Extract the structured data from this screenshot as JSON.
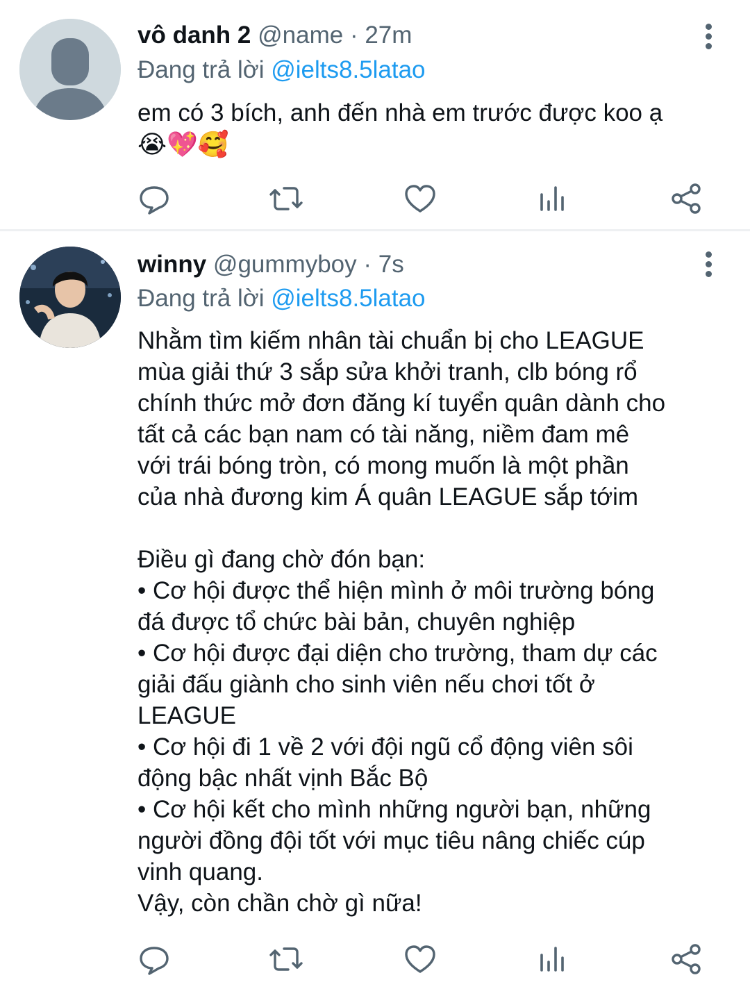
{
  "tweets": [
    {
      "display_name": "vô danh 2",
      "handle": "@name",
      "separator": "·",
      "time": "27m",
      "reply_prefix": "Đang trả lời ",
      "reply_to": "@ielts8.5latao",
      "text": "em có 3 bích, anh đến nhà em trước được koo ạ",
      "emojis": "😭💖🥰",
      "avatar": "default-profile-placeholder"
    },
    {
      "display_name": "winny",
      "handle": "@gummyboy",
      "separator": "·",
      "time": "7s",
      "reply_prefix": "Đang trả lời ",
      "reply_to": "@ielts8.5latao",
      "text": "Nhằm tìm kiếm nhân tài chuẩn bị cho LEAGUE\nmùa giải thứ 3 sắp sửa khởi tranh, clb bóng rổ\nchính thức mở đơn đăng kí tuyển quân dành cho\ntất cả các bạn nam có tài năng, niềm đam mê\nvới trái bóng tròn, có mong muốn là một phần\ncủa nhà đương kim Á quân LEAGUE sắp tớim\n\nĐiều gì đang chờ đón bạn:\n• Cơ hội được thể hiện mình ở môi trường bóng\nđá được tổ chức bài bản, chuyên nghiệp\n• Cơ hội được đại diện cho trường, tham dự các\ngiải đấu giành cho sinh viên nếu chơi tốt ở\nLEAGUE\n• Cơ hội đi 1 về 2 với đội ngũ cổ động viên sôi\nđộng bậc nhất vịnh Bắc Bộ\n• Cơ hội kết cho mình những người bạn, những\nngười đồng đội tốt với mục tiêu nâng chiếc cúp\nvinh quang.\nVậy, còn chần chờ gì nữa!",
      "avatar": "profile-photo"
    }
  ],
  "action_icons": [
    "reply-icon",
    "retweet-icon",
    "like-icon",
    "analytics-icon",
    "share-icon"
  ],
  "colors": {
    "accent": "#1d9bf0",
    "secondary_text": "#536471",
    "primary_text": "#0f1419"
  }
}
